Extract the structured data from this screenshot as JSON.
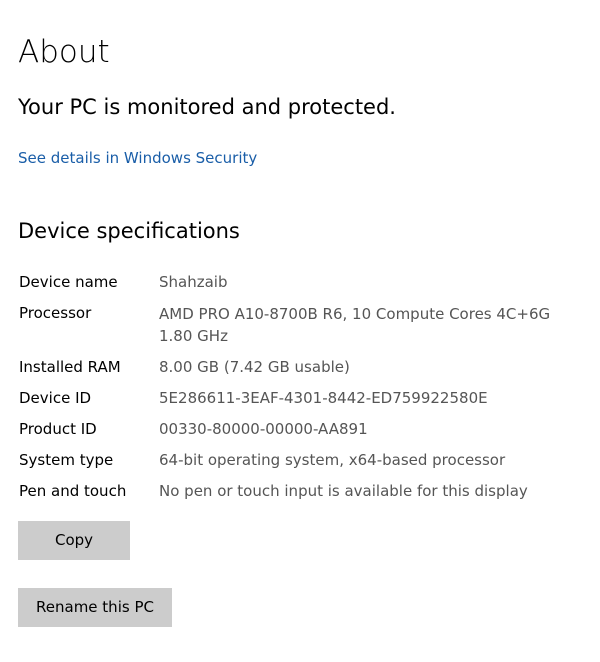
{
  "page": {
    "title": "About"
  },
  "security": {
    "status": "Your PC is monitored and protected.",
    "link_label": "See details in Windows Security"
  },
  "device_specs": {
    "title": "Device specifications",
    "rows": [
      {
        "label": "Device name",
        "value": "Shahzaib"
      },
      {
        "label": "Processor",
        "value": "AMD PRO A10-8700B R6, 10 Compute Cores 4C+6G",
        "value2": "1.80 GHz"
      },
      {
        "label": "Installed RAM",
        "value": "8.00 GB (7.42 GB usable)"
      },
      {
        "label": "Device ID",
        "value": "5E286611-3EAF-4301-8442-ED759922580E"
      },
      {
        "label": "Product ID",
        "value": "00330-80000-00000-AA891"
      },
      {
        "label": "System type",
        "value": "64-bit operating system, x64-based processor"
      },
      {
        "label": "Pen and touch",
        "value": "No pen or touch input is available for this display"
      }
    ]
  },
  "buttons": {
    "copy_label": "Copy",
    "rename_label": "Rename this PC"
  },
  "colors": {
    "link": "#1a5ea8",
    "value_text": "#555555",
    "button_bg": "#cccccc"
  }
}
